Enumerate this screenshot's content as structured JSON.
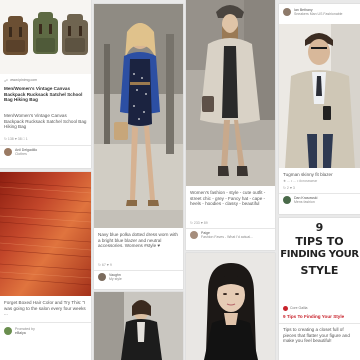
{
  "pins": {
    "bags": {
      "source_url": "www.ipinimg.com",
      "title": "Men/Women's Vintage Canvas Backpack Rucksack Satchel School Bag Hiking Bag",
      "description": "Men/Women's Vintage Canvas Backpack Rucksack Satchel School Bag Hiking Bag",
      "stats": "↻ 138  ♥ 38  □ 1",
      "attribution_name": "Anil Delgadillo",
      "attribution_board": "Clothes"
    },
    "navy_dress": {
      "description": "Navy blue polka dotted dress worn with a bright blue blazer and neutral accessories. Womens #style ♥",
      "stats": "↻ 67  ♥ 9",
      "attribution_name": "Vaughn",
      "attribution_board": "My style"
    },
    "coat_woman": {
      "description": "Women's fashion - style - cute outfit - street chic - grey - Fancy hat - cape - heels - hoodies - classy - beautiful",
      "stats": "↻ 233  ♥ 89",
      "attribution_name": "Paige",
      "attribution_board": "Fashion Faves - What I'd actual..."
    },
    "tugman": {
      "top_name": "Ian Bethany",
      "top_board": "Sneakers Man US Fashionable",
      "description": "Tugman skinny fit blazer",
      "hashtags": "★ ... • ... • #crosswear",
      "stats": "↻ 2  ♥ 3",
      "attribution_name": "Dan Krasowski",
      "attribution_board": "Mens fashion"
    },
    "hair": {
      "description": "Forget Boxed Hair Color and Try This: \"I was going to the salon every four weeks ...",
      "attribution_name": "Promoted by",
      "attribution_board": "eBalya"
    },
    "tips": {
      "line1": "9",
      "line2": "TIPS TO",
      "line3": "FINDING YOUR",
      "line4": "STYLE",
      "source": "Core Gallia",
      "title": "9 Tips To Finding Your Style",
      "description": "Tips to creating a closet full of pieces that flatter your figure and make you feel beautiful!"
    }
  },
  "colors": {
    "background": "#e9e9e9",
    "card": "#ffffff",
    "title_red": "#c8232c"
  }
}
